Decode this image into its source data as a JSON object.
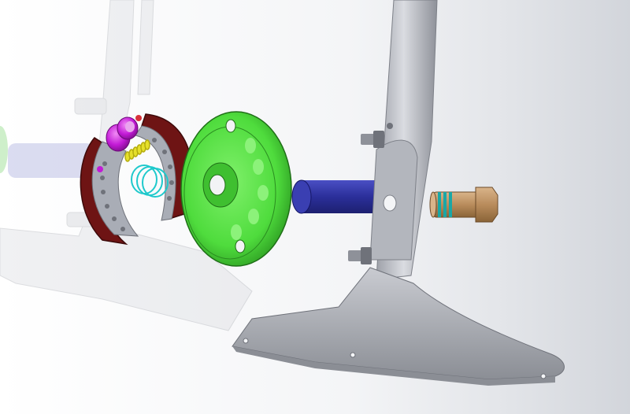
{
  "viewport": {
    "background": [
      "#ffffff",
      "#d2d5db"
    ],
    "interaction": "3d-model-viewport"
  },
  "parts": [
    {
      "name": "ghost-frame",
      "color": "#b8bcc4",
      "transparent": true
    },
    {
      "name": "brake-shoe-assembly",
      "lining_color": "#6e1414",
      "shoe_color": "#a9adb6"
    },
    {
      "name": "brake-cam",
      "color": "#c21ad6"
    },
    {
      "name": "return-spring-yellow",
      "color": "#e6e02a"
    },
    {
      "name": "return-spring-cyan",
      "color": "#1fc9cc"
    },
    {
      "name": "hub-backing-plate",
      "color": "#4fdc3d"
    },
    {
      "name": "axle-tube",
      "color": "#2b2f9a"
    },
    {
      "name": "axle-bolt",
      "color": "#b98c5c",
      "ring_color": "#1aa7a6"
    },
    {
      "name": "frame-leg",
      "color": "#c9cbd1"
    },
    {
      "name": "foot-plate",
      "color": "#c4c6cc"
    }
  ]
}
